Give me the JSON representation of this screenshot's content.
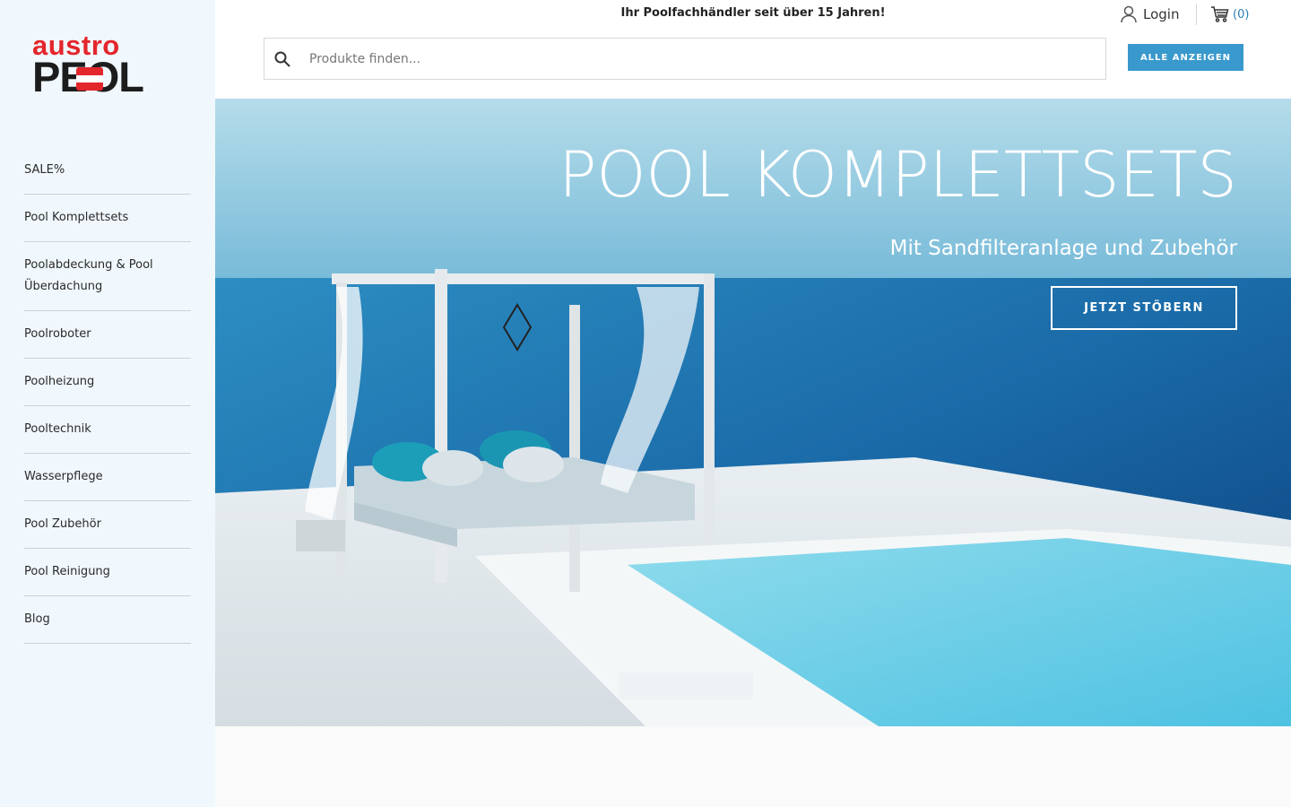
{
  "brand": {
    "logo_top": "austro",
    "logo_bottom": "PEOL",
    "flag_colors": [
      "#e3262c",
      "#ffffff",
      "#e3262c"
    ]
  },
  "sidebar": {
    "items": [
      {
        "label": "SALE%"
      },
      {
        "label": "Pool Komplettsets"
      },
      {
        "label": "Poolabdeckung & Pool Überdachung"
      },
      {
        "label": "Poolroboter"
      },
      {
        "label": "Poolheizung"
      },
      {
        "label": "Pooltechnik"
      },
      {
        "label": "Wasserpflege"
      },
      {
        "label": "Pool Zubehör"
      },
      {
        "label": "Pool Reinigung"
      },
      {
        "label": "Blog"
      }
    ]
  },
  "header": {
    "tagline": "Ihr Poolfachhändler seit über 15 Jahren!",
    "login_label": "Login",
    "cart_count": "(0)",
    "search_placeholder": "Produkte finden...",
    "show_all_label": "ALLE ANZEIGEN"
  },
  "hero": {
    "title": "POOL KOMPLETTSETS",
    "subtitle": "Mit Sandfilteranlage und Zubehör",
    "cta_label": "JETZT STÖBERN"
  },
  "colors": {
    "accent": "#3a99cc",
    "sidebar_bg": "#f1f8fd",
    "cart_text": "#2a7fb8"
  },
  "icons": {
    "search": "search-icon",
    "user": "user-icon",
    "cart": "cart-icon"
  }
}
